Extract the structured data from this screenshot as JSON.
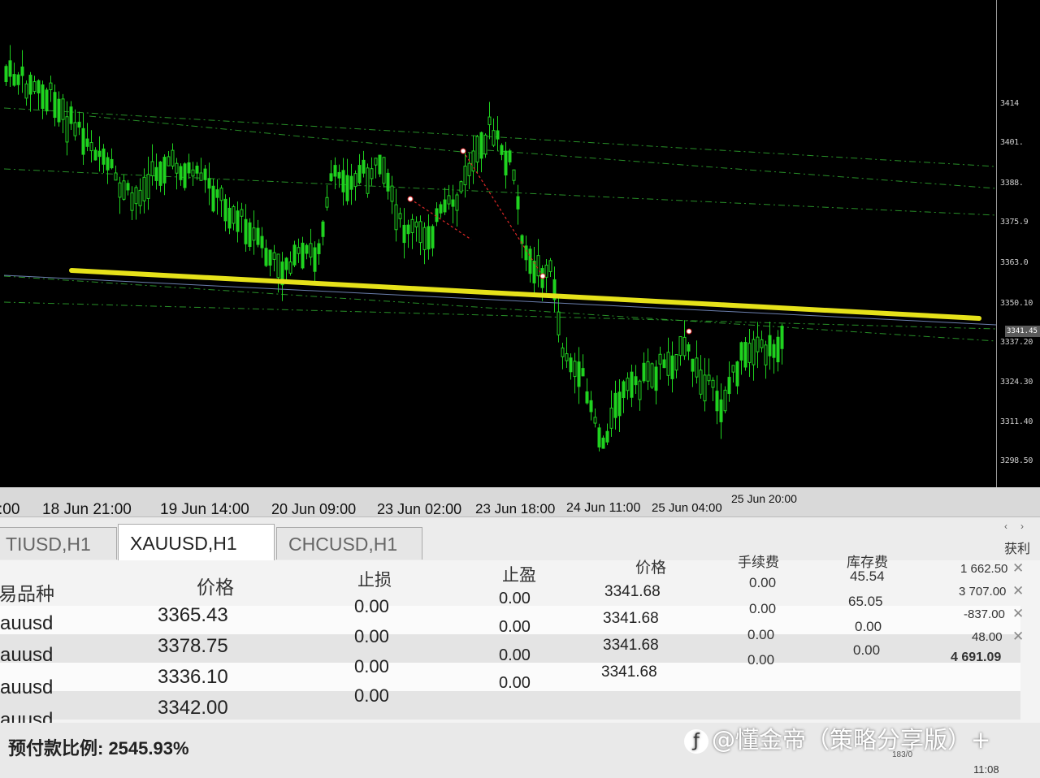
{
  "chart": {
    "price_labels": [
      "3414",
      "3401.",
      "3388.",
      "3375.9",
      "3363.0",
      "3350.10",
      "3337.20",
      "3324.30",
      "3311.40",
      "3298.50"
    ],
    "current_price": "3341.45",
    "time_labels": [
      ":00",
      "18 Jun 21:00",
      "19 Jun 14:00",
      "20 Jun 09:00",
      "23 Jun 02:00",
      "23 Jun 18:00",
      "24 Jun 11:00",
      "25 Jun 04:00",
      "25 Jun 20:00"
    ],
    "colors": {
      "background": "#000000",
      "candles": "#1fd21f",
      "grid": "#2fa82f",
      "trendline": "#e6e21a",
      "arrow": "#e02828"
    }
  },
  "tabs": [
    "TIUSD,H1",
    "XAUUSD,H1",
    "CHCUSD,H1"
  ],
  "tab_controls": [
    "‹",
    "›"
  ],
  "table": {
    "headers": [
      "易品种",
      "价格",
      "止损",
      "止盈",
      "价格",
      "手续费",
      "库存费",
      "获利"
    ],
    "rows": [
      {
        "symbol": "auusd",
        "price": "3365.43",
        "sl": "0.00",
        "tp": "0.00",
        "cur": "3341.68",
        "commission": "0.00",
        "swap": "45.54",
        "profit": "1 662.50"
      },
      {
        "symbol": "auusd",
        "price": "3378.75",
        "sl": "0.00",
        "tp": "0.00",
        "cur": "3341.68",
        "commission": "0.00",
        "swap": "65.05",
        "profit": "3 707.00"
      },
      {
        "symbol": "auusd",
        "price": "3336.10",
        "sl": "0.00",
        "tp": "0.00",
        "cur": "3341.68",
        "commission": "0.00",
        "swap": "0.00",
        "profit": "-837.00"
      },
      {
        "symbol": "auusd",
        "price": "3342.00",
        "sl": "0.00",
        "tp": "0.00",
        "cur": "3341.68",
        "commission": "0.00",
        "swap": "0.00",
        "profit": "48.00"
      }
    ],
    "total_profit": "4 691.09"
  },
  "footer": {
    "margin_level": "预付款比例: 2545.93%",
    "watermark": "@懂金帝（策略分享版）+",
    "signal": "183/0",
    "clock": "11:08"
  }
}
